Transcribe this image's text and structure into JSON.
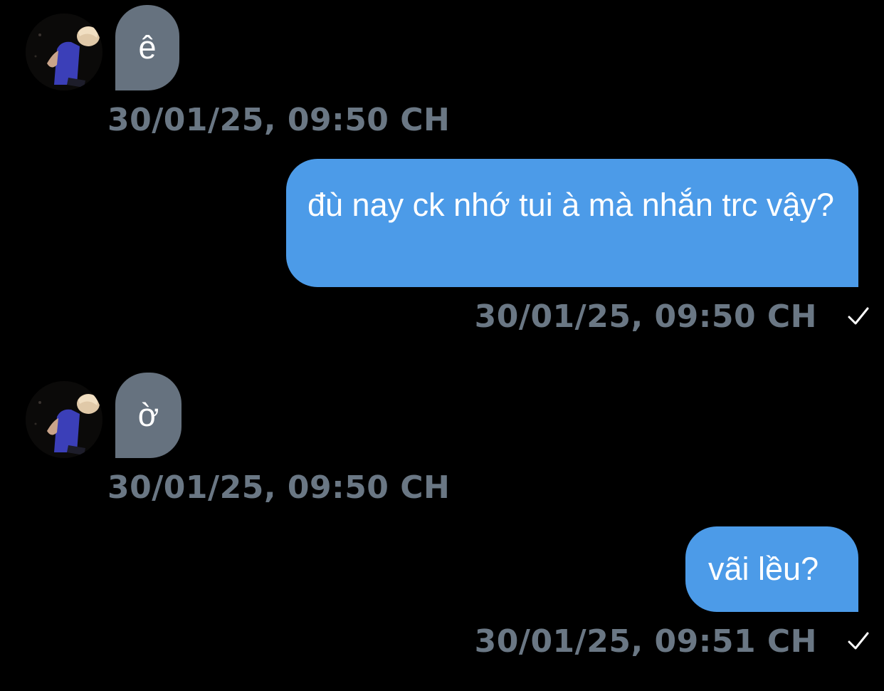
{
  "messages": [
    {
      "direction": "incoming",
      "text": "ê",
      "timestamp": "30/01/25, 09:50 CH",
      "avatar": "contact-avatar-photo"
    },
    {
      "direction": "outgoing",
      "text": "đù nay ck nhớ tui à mà nhắn trc vậy?",
      "timestamp": "30/01/25, 09:50 CH",
      "status_icon": "check-icon"
    },
    {
      "direction": "incoming",
      "text": "ờ",
      "timestamp": "30/01/25, 09:50 CH",
      "avatar": "contact-avatar-photo"
    },
    {
      "direction": "outgoing",
      "text": "vãi lều?",
      "timestamp": "30/01/25, 09:51 CH",
      "status_icon": "check-icon"
    }
  ],
  "colors": {
    "background": "#000000",
    "incoming_bubble": "#66727f",
    "outgoing_bubble": "#4c9be8",
    "timestamp_text": "#6a7784",
    "message_text": "#ffffff"
  }
}
